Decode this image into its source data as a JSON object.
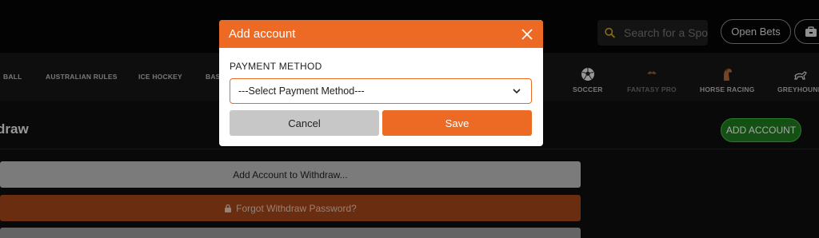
{
  "header": {
    "search_placeholder": "Search for a Spo",
    "open_bets_label": "Open Bets"
  },
  "sports_nav": [
    {
      "label": "BALL",
      "icon": null
    },
    {
      "label": "AUSTRALIAN RULES",
      "icon": null
    },
    {
      "label": "ICE HOCKEY",
      "icon": null
    },
    {
      "label": "BAS",
      "icon": null
    },
    {
      "label": "SOCCER",
      "icon": "soccer-ball-icon"
    },
    {
      "label": "FANTASY PRO",
      "icon": "fantasy-pro-icon"
    },
    {
      "label": "HORSE RACING",
      "icon": "horse-icon"
    },
    {
      "label": "GREYHOUND",
      "icon": "greyhound-icon"
    }
  ],
  "page": {
    "title": "draw",
    "add_account_button": "ADD ACCOUNT",
    "add_account_row": "Add Account to Withdraw...",
    "forgot_password_row": "Forgot Withdraw Password?"
  },
  "modal": {
    "title": "Add account",
    "field_label": "PAYMENT METHOD",
    "select_value": "---Select Payment Method---",
    "cancel_label": "Cancel",
    "save_label": "Save"
  },
  "colors": {
    "accent": "#ed6a24",
    "success": "#1f7a1f",
    "background": "#0e0e0e"
  }
}
